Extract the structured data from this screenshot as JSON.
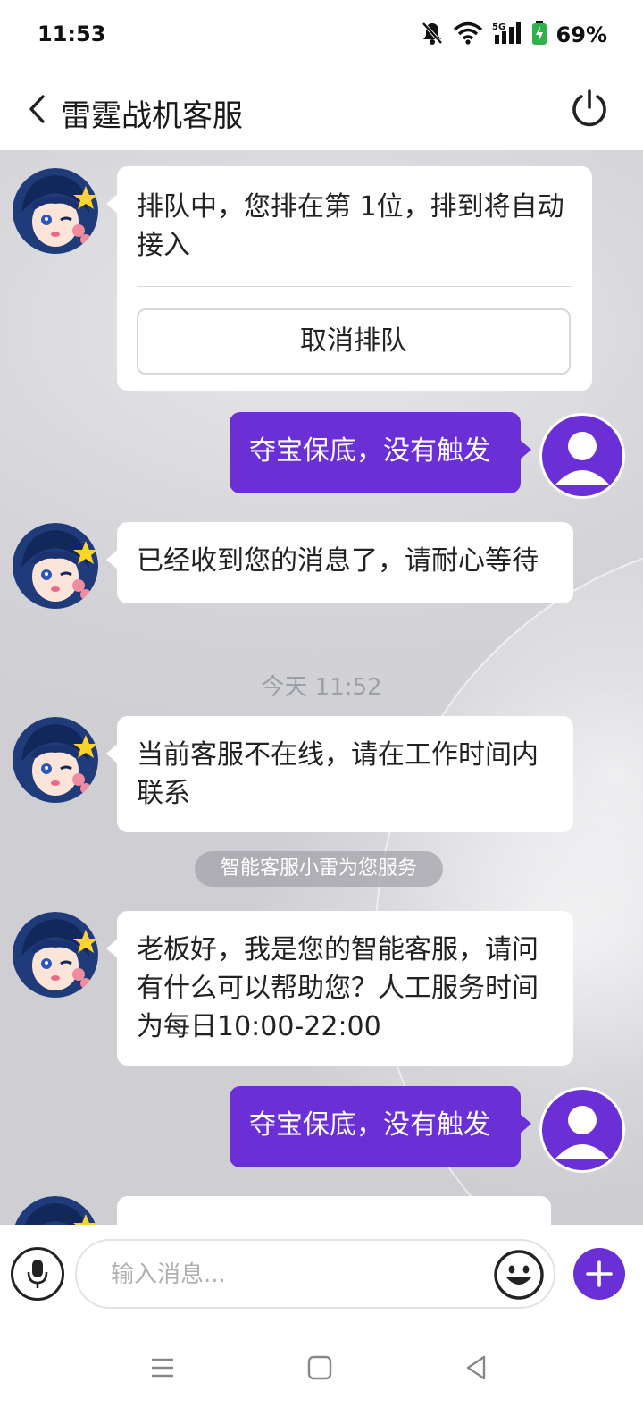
{
  "status_bar": {
    "time": "11:53",
    "battery_percent": "69%",
    "icons": [
      "bell-muted-icon",
      "wifi-icon",
      "5g-signal-icon",
      "battery-charging-icon"
    ]
  },
  "header": {
    "title": "雷霆战机客服",
    "back_icon": "chevron-left-icon",
    "power_icon": "power-icon"
  },
  "messages": [
    {
      "direction": "in",
      "text": "排队中，您排在第 1位，排到将自动接入",
      "action_label": "取消排队"
    },
    {
      "direction": "out",
      "text": "夺宝保底，没有触发"
    },
    {
      "direction": "in",
      "text": "已经收到您的消息了，请耐心等待"
    },
    {
      "type": "timestamp",
      "text": "今天 11:52"
    },
    {
      "direction": "in",
      "text": "当前客服不在线，请在工作时间内联系"
    },
    {
      "type": "notice",
      "text": "智能客服小雷为您服务"
    },
    {
      "direction": "in",
      "text": "老板好，我是您的智能客服，请问有什么可以帮助您？人工服务时间为每日10:00-22:00"
    },
    {
      "direction": "out",
      "text": "夺宝保底，没有触发"
    }
  ],
  "input_bar": {
    "placeholder": "输入消息...",
    "icons": [
      "microphone-icon",
      "emoji-icon",
      "plus-icon"
    ]
  },
  "nav_bar": {
    "icons": [
      "menu-icon",
      "home-icon",
      "back-icon"
    ]
  },
  "colors": {
    "accent": "#6b2fd6",
    "bubble_in": "#ffffff",
    "timestamp": "#9aa0a6"
  }
}
